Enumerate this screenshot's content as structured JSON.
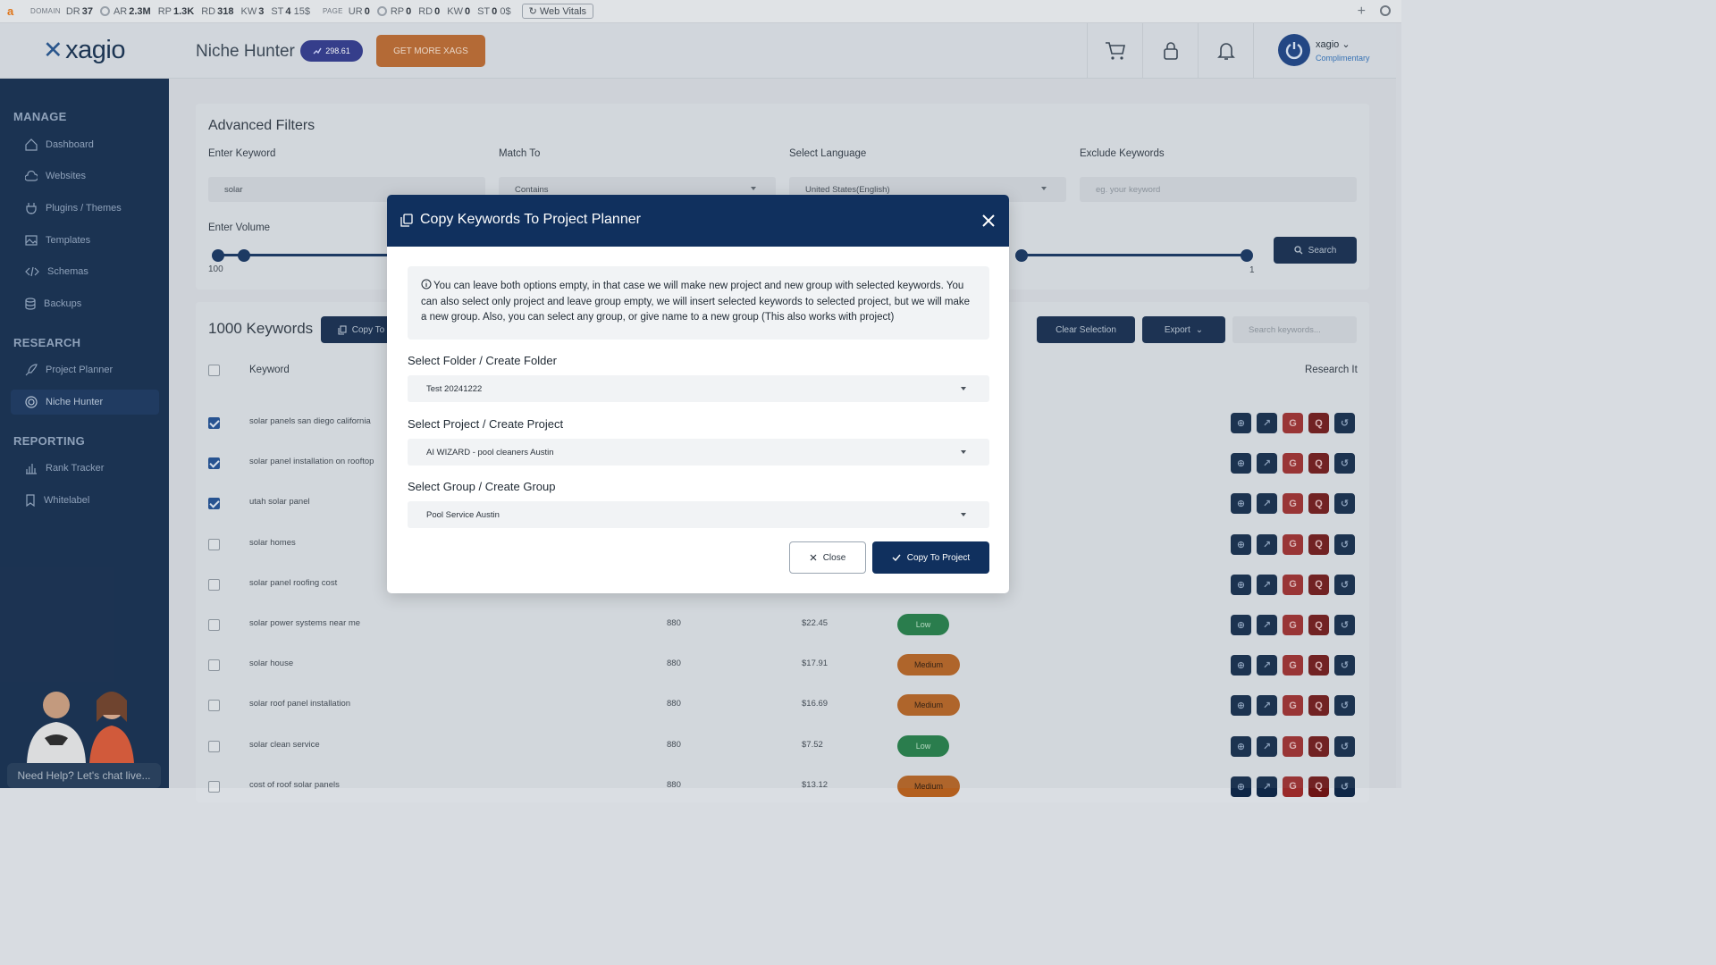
{
  "seo_bar": {
    "domain_label": "DOMAIN",
    "dr_label": "DR",
    "dr": "37",
    "ar_label": "AR",
    "ar": "2.3M",
    "rp_label": "RP",
    "rp": "1.3K",
    "rd_label": "RD",
    "rd": "318",
    "kw_label": "KW",
    "kw": "3",
    "st_label": "ST",
    "st": "4",
    "st_value": "15$",
    "page_label": "PAGE",
    "ur_label": "UR",
    "ur": "0",
    "page_rp_label": "RP",
    "page_rp": "0",
    "page_rd_label": "RD",
    "page_rd": "0",
    "page_kw_label": "KW",
    "page_kw": "0",
    "page_st_label": "ST",
    "page_st": "0",
    "page_st_value": "0$",
    "web_vitals": "Web Vitals"
  },
  "header": {
    "brand": "xagio",
    "page_title": "Niche Hunter",
    "xags_balance": "298.61",
    "get_more": "GET MORE XAGS",
    "username": "xagio",
    "plan": "Complimentary"
  },
  "sidebar": {
    "manage_title": "MANAGE",
    "manage": [
      {
        "label": "Dashboard",
        "icon": "home-icon"
      },
      {
        "label": "Websites",
        "icon": "cloud-icon"
      },
      {
        "label": "Plugins / Themes",
        "icon": "plug-icon"
      },
      {
        "label": "Templates",
        "icon": "image-icon"
      },
      {
        "label": "Schemas",
        "icon": "code-icon"
      },
      {
        "label": "Backups",
        "icon": "database-icon"
      }
    ],
    "research_title": "RESEARCH",
    "research": [
      {
        "label": "Project Planner",
        "icon": "rocket-icon"
      },
      {
        "label": "Niche Hunter",
        "icon": "target-icon"
      }
    ],
    "reporting_title": "REPORTING",
    "reporting": [
      {
        "label": "Rank Tracker",
        "icon": "bar-chart-icon"
      },
      {
        "label": "Whitelabel",
        "icon": "bookmark-icon"
      }
    ],
    "help_chat": "Need Help? Let's chat live..."
  },
  "filters": {
    "title": "Advanced Filters",
    "keyword_label": "Enter Keyword",
    "keyword_value": "solar",
    "match_label": "Match To",
    "match_value": "Contains",
    "language_label": "Select Language",
    "language_value": "United States(English)",
    "exclude_label": "Exclude Keywords",
    "exclude_placeholder": "eg. your keyword",
    "volume_label": "Enter Volume",
    "volume_min": "100",
    "right_slider_value": "1",
    "search_button": "Search"
  },
  "results": {
    "count_title": "1000 Keywords",
    "copy_button": "Copy To",
    "clear_selection": "Clear Selection",
    "export": "Export",
    "search_placeholder": "Search keywords...",
    "col_keyword": "Keyword",
    "col_research": "Research It",
    "rows": [
      {
        "keyword": "solar panels san diego california",
        "checked": true,
        "volume": "",
        "cpc": "",
        "competition": "",
        "level": ""
      },
      {
        "keyword": "solar panel installation on rooftop",
        "checked": true,
        "volume": "",
        "cpc": "",
        "competition": "",
        "level": ""
      },
      {
        "keyword": "utah solar panel",
        "checked": true,
        "volume": "",
        "cpc": "",
        "competition": "",
        "level": ""
      },
      {
        "keyword": "solar homes",
        "checked": false,
        "volume": "",
        "cpc": "",
        "competition": "",
        "level": ""
      },
      {
        "keyword": "solar panel roofing cost",
        "checked": false,
        "volume": "",
        "cpc": "",
        "competition": "",
        "level": ""
      },
      {
        "keyword": "solar power systems near me",
        "checked": false,
        "volume": "880",
        "cpc": "$22.45",
        "competition": "Low",
        "level": "low"
      },
      {
        "keyword": "solar house",
        "checked": false,
        "volume": "880",
        "cpc": "$17.91",
        "competition": "Medium",
        "level": "med"
      },
      {
        "keyword": "solar roof panel installation",
        "checked": false,
        "volume": "880",
        "cpc": "$16.69",
        "competition": "Medium",
        "level": "med"
      },
      {
        "keyword": "solar clean service",
        "checked": false,
        "volume": "880",
        "cpc": "$7.52",
        "competition": "Low",
        "level": "low"
      },
      {
        "keyword": "cost of roof solar panels",
        "checked": false,
        "volume": "880",
        "cpc": "$13.12",
        "competition": "Medium",
        "level": "med"
      }
    ]
  },
  "modal": {
    "title": "Copy Keywords To Project Planner",
    "info": "You can leave both options empty, in that case we will make new project and new group with selected keywords. You can also select only project and leave group empty, we will insert selected keywords to selected project, but we will make a new group. Also, you can select any group, or give name to a new group (This also works with project)",
    "folder_label": "Select Folder / Create Folder",
    "folder_value": "Test 20241222",
    "project_label": "Select Project / Create Project",
    "project_value": "AI WIZARD - pool cleaners Austin",
    "group_label": "Select Group / Create Group",
    "group_value": "Pool Service Austin",
    "close_button": "Close",
    "copy_button": "Copy To Project"
  },
  "colors": {
    "navy": "#10305e",
    "sidebar": "#0e2749",
    "accent_orange": "#b8652a",
    "low_green": "#1f7a43",
    "medium_orange": "#b35f1e"
  }
}
